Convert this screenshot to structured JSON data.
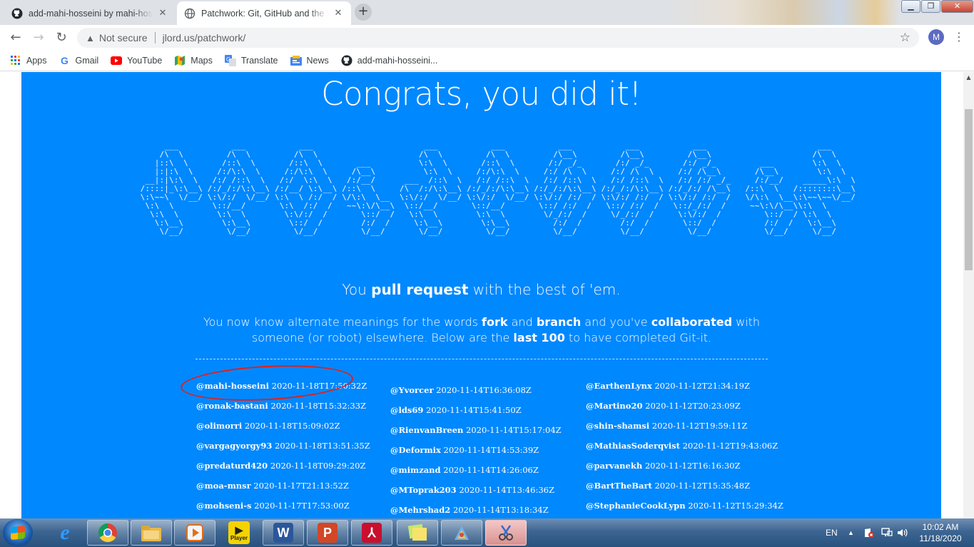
{
  "browser": {
    "tabs": [
      {
        "title": "add-mahi-hosseini by mahi-hosseini",
        "icon": "github-icon"
      },
      {
        "title": "Patchwork: Git, GitHub and the Patchwork",
        "icon": "globe-icon"
      }
    ],
    "new_tab": "+",
    "security_label": "Not secure",
    "url": "jlord.us/patchwork/",
    "profile_initial": "M",
    "bookmarks": [
      {
        "label": "Apps",
        "icon": "apps-grid-icon"
      },
      {
        "label": "Gmail",
        "icon": "google-icon"
      },
      {
        "label": "YouTube",
        "icon": "youtube-icon"
      },
      {
        "label": "Maps",
        "icon": "maps-icon"
      },
      {
        "label": "Translate",
        "icon": "translate-icon"
      },
      {
        "label": "News",
        "icon": "news-icon"
      },
      {
        "label": "add-mahi-hosseini...",
        "icon": "github-icon"
      }
    ]
  },
  "page": {
    "headline": "Congrats, you did it!",
    "lead": {
      "pre": "You ",
      "bold": "pull request",
      "post": " with the best of 'em."
    },
    "para": {
      "p1": "You now know alternate meanings for the words ",
      "b1": "fork",
      "p2": " and ",
      "b2": "branch",
      "p3": " and you've ",
      "b3": "collaborated",
      "p4": " with someone (or robot) elsewhere. Below are the ",
      "b4": "last 100",
      "p5": " to have completed Git-it."
    },
    "columns": [
      [
        {
          "user": "@mahi-hosseini",
          "time": "2020-11-18T17:50:32Z"
        },
        {
          "user": "@ronak-bastani",
          "time": "2020-11-18T15:32:33Z"
        },
        {
          "user": "@olimorri",
          "time": "2020-11-18T15:09:02Z"
        },
        {
          "user": "@vargagyorgy93",
          "time": "2020-11-18T13:51:35Z"
        },
        {
          "user": "@predaturd420",
          "time": "2020-11-18T09:29:20Z"
        },
        {
          "user": "@moa-mnsr",
          "time": "2020-11-17T21:13:52Z"
        },
        {
          "user": "@mohseni-s",
          "time": "2020-11-17T17:53:00Z"
        }
      ],
      [
        {
          "user": "@Yvorcer",
          "time": "2020-11-14T16:36:08Z"
        },
        {
          "user": "@lds69",
          "time": "2020-11-14T15:41:50Z"
        },
        {
          "user": "@RienvanBreen",
          "time": "2020-11-14T15:17:04Z"
        },
        {
          "user": "@Deformix",
          "time": "2020-11-14T14:53:39Z"
        },
        {
          "user": "@mimzand",
          "time": "2020-11-14T14:26:06Z"
        },
        {
          "user": "@MToprak203",
          "time": "2020-11-14T13:46:36Z"
        },
        {
          "user": "@Mehrshad2",
          "time": "2020-11-14T13:18:34Z"
        }
      ],
      [
        {
          "user": "@EarthenLynx",
          "time": "2020-11-12T21:34:19Z"
        },
        {
          "user": "@Martino20",
          "time": "2020-11-12T20:23:09Z"
        },
        {
          "user": "@shin-shamsi",
          "time": "2020-11-12T19:59:11Z"
        },
        {
          "user": "@MathiasSoderqvist",
          "time": "2020-11-12T19:43:06Z"
        },
        {
          "user": "@parvanekh",
          "time": "2020-11-12T16:16:30Z"
        },
        {
          "user": "@BartTheBart",
          "time": "2020-11-12T15:35:48Z"
        },
        {
          "user": "@StephanieCookLypn",
          "time": "2020-11-12T15:29:34Z"
        }
      ]
    ],
    "colors": {
      "panel": "#0088ff",
      "highlight_circle": "#e0201c"
    }
  },
  "taskbar": {
    "apps": [
      "internet-explorer-icon",
      "chrome-icon",
      "file-explorer-icon",
      "media-player-icon",
      "player-icon",
      "word-icon",
      "powerpoint-icon",
      "acrobat-icon",
      "sticky-notes-icon",
      "snipping-tool-icon",
      "paint-icon"
    ],
    "player_label": "Player",
    "language": "EN",
    "time": "10:02 AM",
    "date": "11/18/2020"
  }
}
